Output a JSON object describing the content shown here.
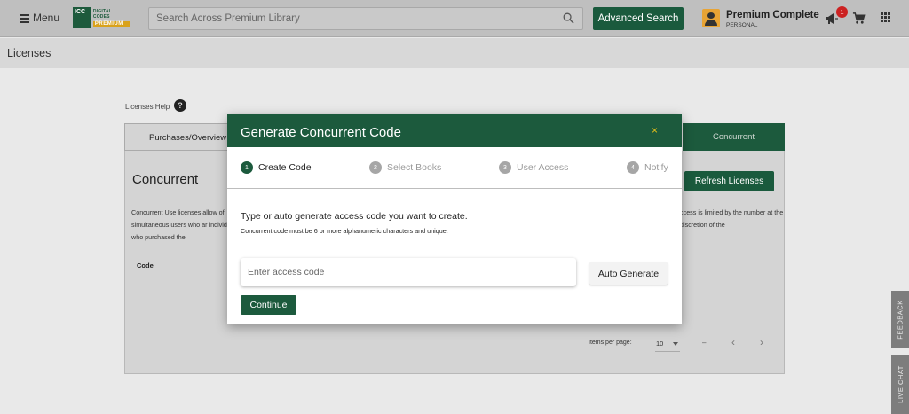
{
  "header": {
    "menu_label": "Menu",
    "logo_line1": "DIGITAL CODES",
    "logo_line2": "PREMIUM",
    "logo_mark": "ICC",
    "search_placeholder": "Search Across Premium Library",
    "advanced_search_label": "Advanced Search",
    "user_name": "Premium Complete",
    "user_plan": "PERSONAL",
    "notification_count": "1",
    "icons": [
      "menu-icon",
      "search-icon",
      "user-avatar-icon",
      "megaphone-icon",
      "cart-icon",
      "apps-grid-icon"
    ]
  },
  "page": {
    "title": "Licenses",
    "help_label": "Licenses Help",
    "help_icon_glyph": "?",
    "tabs": [
      {
        "label": "Purchases/Overview"
      },
      {
        "label": "Concurrent"
      }
    ],
    "section_title": "Concurrent",
    "description_left": "Concurrent Use licenses allow of simultaneous users who ar individual who purchased the",
    "description_right": "ccess is limited by the number at the discretion of the",
    "refresh_label": "Refresh Licenses",
    "table": {
      "columns": [
        "Code"
      ]
    },
    "paginator": {
      "items_per_page_label": "Items per page:",
      "page_size": "10",
      "range_label": "–",
      "prev_glyph": "‹",
      "next_glyph": "›"
    }
  },
  "side_tabs": {
    "feedback": "FEEDBACK",
    "live_chat": "LIVE CHAT"
  },
  "modal": {
    "title": "Generate Concurrent Code",
    "close_glyph": "×",
    "steps": [
      {
        "num": "1",
        "label": "Create Code",
        "active": true
      },
      {
        "num": "2",
        "label": "Select Books",
        "active": false
      },
      {
        "num": "3",
        "label": "User Access",
        "active": false
      },
      {
        "num": "4",
        "label": "Notify",
        "active": false
      }
    ],
    "instruction": "Type or auto generate access code you want to create.",
    "instruction_sub": "Concurrent code must be 6 or more alphanumeric characters and unique.",
    "code_input": {
      "placeholder": "Enter access code",
      "value": ""
    },
    "auto_generate_label": "Auto Generate",
    "continue_label": "Continue"
  },
  "colors": {
    "brand_green": "#1c5a3d",
    "accent_gold": "#e8c11a",
    "badge_red": "#cc2222"
  }
}
